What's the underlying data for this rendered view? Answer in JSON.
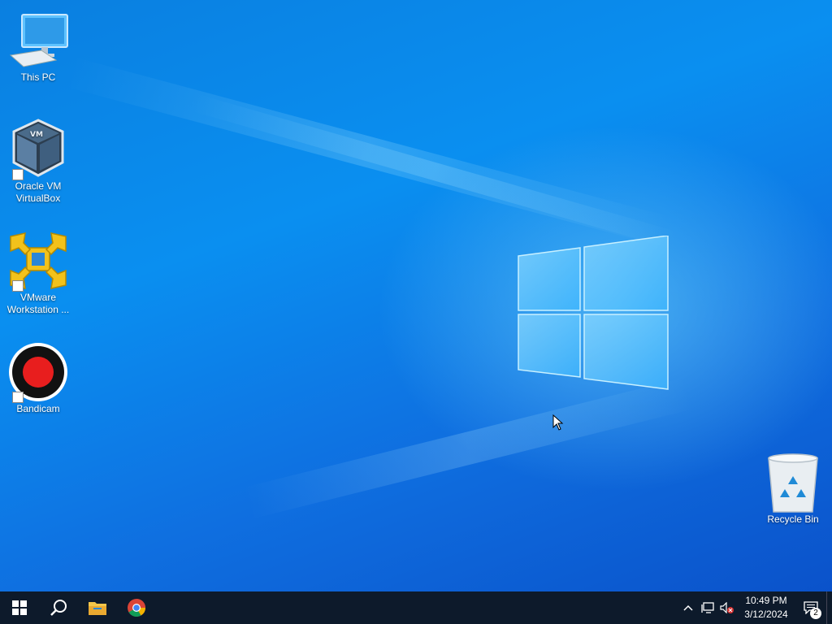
{
  "desktop": {
    "icons": [
      {
        "label": "This PC",
        "icon": "this-pc-icon"
      },
      {
        "label": "Oracle VM VirtualBox",
        "icon": "virtualbox-icon"
      },
      {
        "label": "VMware Workstation ...",
        "icon": "vmware-icon"
      },
      {
        "label": "Bandicam",
        "icon": "bandicam-icon"
      },
      {
        "label": "Recycle Bin",
        "icon": "recycle-bin-icon"
      }
    ]
  },
  "taskbar": {
    "apps": [
      {
        "name": "start",
        "icon": "windows-start-icon"
      },
      {
        "name": "search",
        "icon": "search-icon"
      },
      {
        "name": "file-explorer",
        "icon": "folder-icon"
      },
      {
        "name": "chrome",
        "icon": "chrome-icon"
      }
    ],
    "tray": {
      "time": "10:49 PM",
      "date": "3/12/2024",
      "notification_count": "2"
    }
  },
  "colors": {
    "taskbar": "#0d1a2b",
    "wallpaper": "#0a8ff0"
  }
}
